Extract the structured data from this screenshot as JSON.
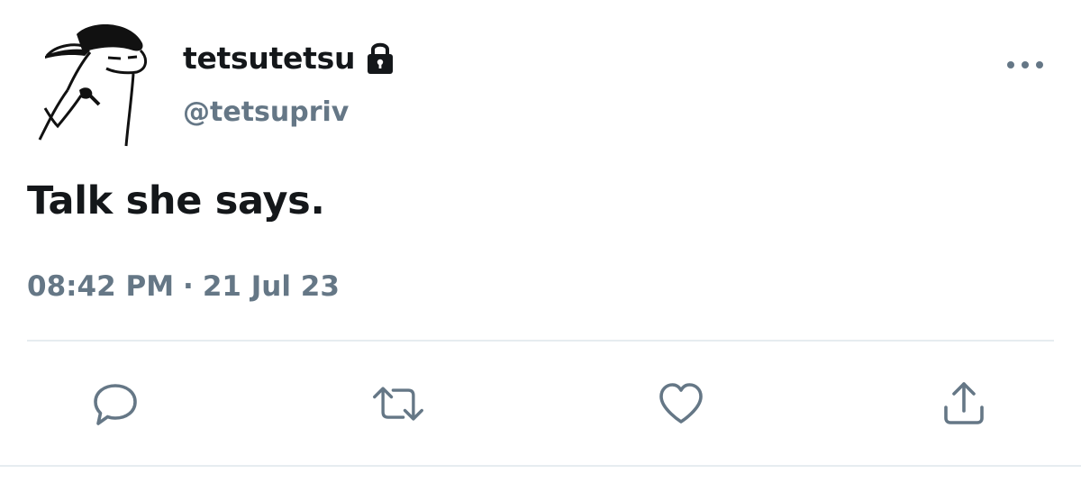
{
  "tweet": {
    "display_name": "tetsutetsu",
    "handle": "@tetsupriv",
    "protected_icon": "lock-icon",
    "text": "Talk she says.",
    "time": "08:42 PM",
    "separator": "·",
    "date": "21 Jul 23"
  },
  "header": {
    "more_icon": "more-horizontal-icon"
  },
  "actions": [
    {
      "name": "reply",
      "icon": "speech-bubble-icon"
    },
    {
      "name": "retweet",
      "icon": "retweet-arrows-icon"
    },
    {
      "name": "like",
      "icon": "heart-icon"
    },
    {
      "name": "share",
      "icon": "share-upload-icon"
    }
  ],
  "colors": {
    "text_primary": "#14171a",
    "text_secondary": "#657786",
    "divider": "#e6ecf0",
    "background": "#ffffff"
  }
}
